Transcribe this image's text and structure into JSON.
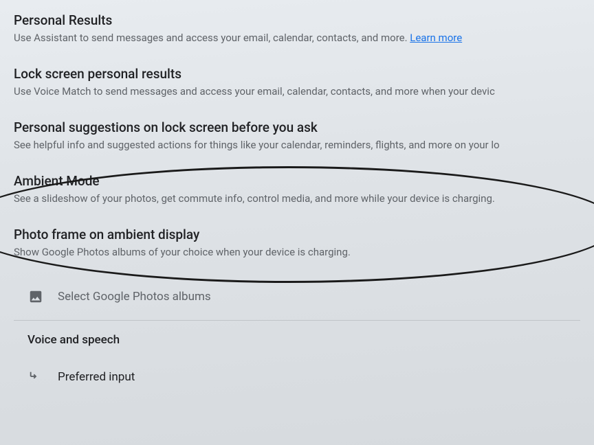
{
  "personal_results": {
    "title": "Personal Results",
    "desc": "Use Assistant to send messages and access your email, calendar, contacts, and more. ",
    "link": "Learn more"
  },
  "lock_screen": {
    "title": "Lock screen personal results",
    "desc": "Use Voice Match to send messages and access your email, calendar, contacts, and more when your devic"
  },
  "personal_suggestions": {
    "title": "Personal suggestions on lock screen before you ask",
    "desc": "See helpful info and suggested actions for things like your calendar, reminders, flights, and more on your lo"
  },
  "ambient_mode": {
    "title": "Ambient Mode",
    "desc": "See a slideshow of your photos, get commute info, control media, and more while your device is charging."
  },
  "photo_frame": {
    "title": "Photo frame on ambient display",
    "desc": "Show Google Photos albums of your choice when your device is charging."
  },
  "select_albums": {
    "label": "Select Google Photos albums"
  },
  "voice_speech": {
    "header": "Voice and speech"
  },
  "preferred_input": {
    "label": "Preferred input"
  }
}
